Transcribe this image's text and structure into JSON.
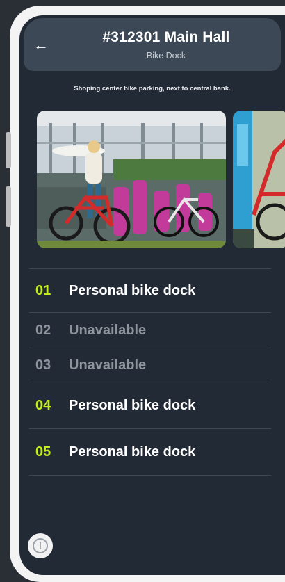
{
  "header": {
    "back_icon": "arrow-left-icon",
    "title": "#312301 Main Hall",
    "subtitle": "Bike Dock"
  },
  "description": "Shoping center bike parking, next to central bank.",
  "gallery": {
    "photos": [
      "bike-dock-photo",
      "bike-dock-photo-partial"
    ]
  },
  "docks": [
    {
      "number": "01",
      "label": "Personal bike dock",
      "status": "available"
    },
    {
      "number": "02",
      "label": "Unavailable",
      "status": "unavailable"
    },
    {
      "number": "03",
      "label": "Unavailable",
      "status": "unavailable"
    },
    {
      "number": "04",
      "label": "Personal bike dock",
      "status": "available"
    },
    {
      "number": "05",
      "label": "Personal bike dock",
      "status": "available"
    }
  ],
  "info_button": {
    "icon": "info-icon",
    "glyph": "!"
  },
  "colors": {
    "background": "#222a35",
    "header": "#3c4856",
    "accent": "#c4ec1f",
    "muted": "#8e949c"
  }
}
